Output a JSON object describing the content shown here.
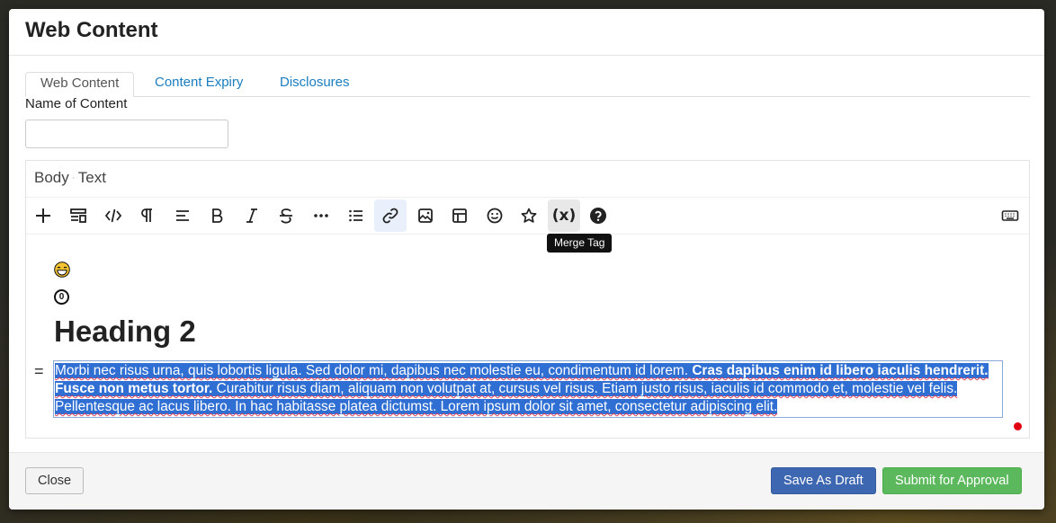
{
  "modal": {
    "title": "Web Content"
  },
  "tabs": [
    {
      "label": "Web Content",
      "active": true
    },
    {
      "label": "Content Expiry",
      "active": false
    },
    {
      "label": "Disclosures",
      "active": false
    }
  ],
  "form": {
    "name_label": "Name of Content",
    "name_value": "",
    "name_placeholder": ""
  },
  "editor": {
    "title_part1": "Body",
    "title_separator": "·",
    "title_part2": "Text",
    "toolbar": [
      {
        "name": "insert-block-icon"
      },
      {
        "name": "block-type-icon"
      },
      {
        "name": "code-view-icon"
      },
      {
        "name": "paragraph-icon"
      },
      {
        "name": "align-icon"
      },
      {
        "name": "bold-icon"
      },
      {
        "name": "italic-icon"
      },
      {
        "name": "strikethrough-icon"
      },
      {
        "name": "more-icon"
      },
      {
        "name": "list-icon"
      },
      {
        "name": "link-icon",
        "active": true
      },
      {
        "name": "image-icon"
      },
      {
        "name": "table-icon"
      },
      {
        "name": "emoji-icon"
      },
      {
        "name": "star-icon"
      },
      {
        "name": "merge-tag-icon",
        "label": "(x)",
        "hover": true
      },
      {
        "name": "help-icon"
      },
      {
        "name": "keyboard-icon"
      }
    ],
    "tooltip": "Merge Tag",
    "content": {
      "circled_digit": "0",
      "heading": "Heading 2",
      "drag_handle": "=",
      "para_part1": "Morbi nec risus urna, quis lobortis ligula. Sed dolor mi, dapibus nec molestie eu, condimentum id lorem. ",
      "para_bold": "Cras dapibus enim id libero iaculis hendrerit. Fusce non metus tortor.",
      "para_part2": " Curabitur risus diam, aliquam non volutpat at, cursus vel risus. Etiam justo risus, iaculis id commodo et, molestie vel felis. Pellentesque ac lacus libero. In hac habitasse platea dictumst. Lorem ipsum dolor sit amet, consectetur adipiscing elit."
    }
  },
  "footer": {
    "close_label": "Close",
    "draft_label": "Save As Draft",
    "submit_label": "Submit for Approval"
  },
  "colors": {
    "link": "#1a7dbf",
    "selection": "#2f6fd3",
    "draft_button": "#3e67b1",
    "submit_button": "#5cb85c",
    "indicator_dot": "#e00010"
  }
}
